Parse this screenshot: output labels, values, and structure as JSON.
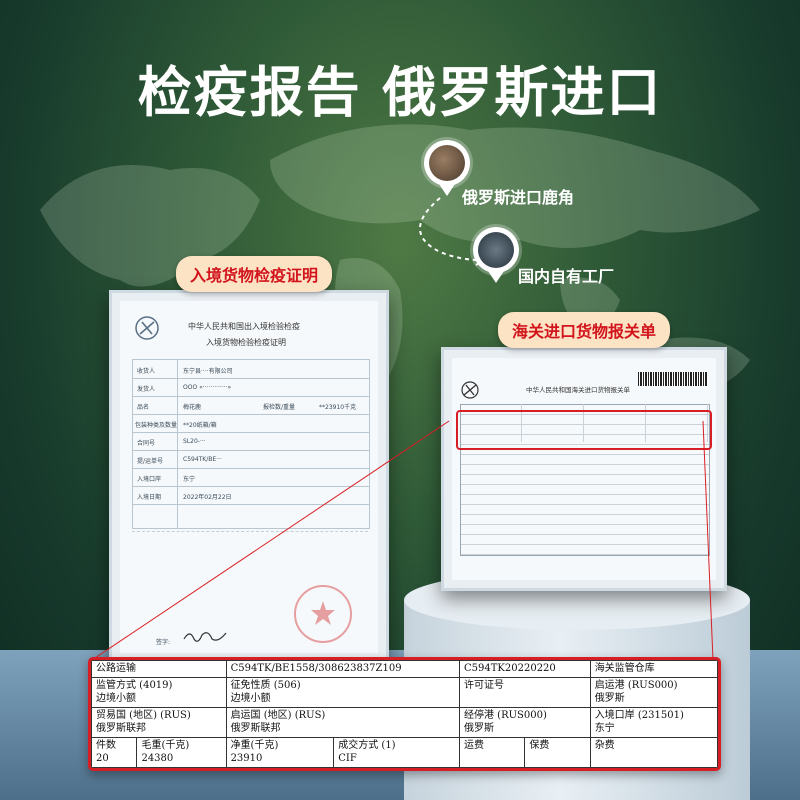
{
  "title": "检疫报告 俄罗斯进口",
  "route": {
    "origin_label": "俄罗斯进口鹿角",
    "destination_label": "国内自有工厂"
  },
  "left_certificate": {
    "tag": "入境货物检疫证明",
    "header_line1": "中华人民共和国出入境检验检疫",
    "header_line2": "入境货物检验检疫证明",
    "rows": [
      {
        "label": "收货人",
        "value": "东宁县····有限公司"
      },
      {
        "label": "发货人",
        "value": "OOO «·············»"
      },
      {
        "label": "品名",
        "value": "梅花鹿"
      },
      {
        "label": "报检数/重量",
        "value": "**23910千克"
      },
      {
        "label": "包装种类及数量",
        "value": "**20纸箱/箱"
      },
      {
        "label": "合同号",
        "value": "SL20-···"
      },
      {
        "label": "提/运单号",
        "value": "C594TK/BE···"
      },
      {
        "label": "入境口岸",
        "value": "东宁"
      },
      {
        "label": "入境日期",
        "value": "2022年02月22日"
      }
    ],
    "stamp_text": "中华人民共和国东宁海关",
    "signature_label": "签字:"
  },
  "right_certificate": {
    "tag": "海关进口货物报关单",
    "header": "中华人民共和国海关进口货物报关单"
  },
  "zoom_table": {
    "row1": [
      "公路运输",
      "C594TK/BE1558/308623837Z109",
      "C594TK20220220",
      "海关监管仓库"
    ],
    "row2": [
      {
        "label": "监管方式 (4019)",
        "value": "边境小额"
      },
      {
        "label": "征免性质 (506)",
        "value": "边境小额"
      },
      {
        "label": "许可证号",
        "value": ""
      },
      {
        "label": "启运港 (RUS000)",
        "value": "俄罗斯"
      }
    ],
    "row3": [
      {
        "label": "贸易国 (地区) (RUS)",
        "value": "俄罗斯联邦"
      },
      {
        "label": "启运国 (地区) (RUS)",
        "value": "俄罗斯联邦"
      },
      {
        "label": "经停港 (RUS000)",
        "value": "俄罗斯"
      },
      {
        "label": "入境口岸 (231501)",
        "value": "东宁"
      }
    ],
    "row4": [
      {
        "label": "件数",
        "value": "20"
      },
      {
        "label": "毛重(千克)",
        "value": "24380"
      },
      {
        "label": "净重(千克)",
        "value": "23910"
      },
      {
        "label": "成交方式 (1)",
        "value": "CIF"
      },
      {
        "label": "运费",
        "value": ""
      },
      {
        "label": "保费",
        "value": ""
      },
      {
        "label": "杂费",
        "value": ""
      }
    ]
  },
  "colors": {
    "accent_red": "#d81e25",
    "tag_bg": "#fbe3c4",
    "bg_green": "#2f5a37"
  }
}
